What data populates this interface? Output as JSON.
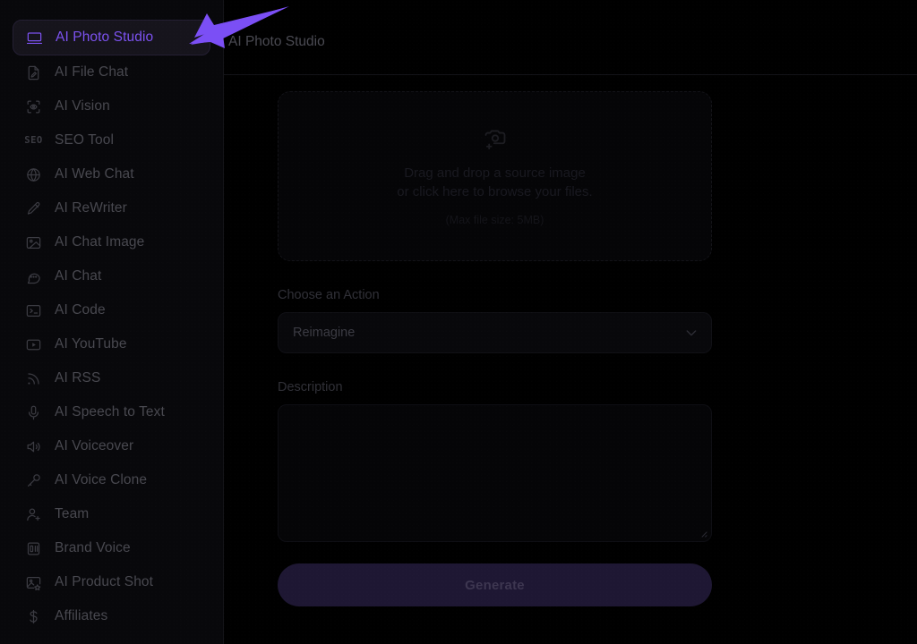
{
  "theme": {
    "accent": "#7c52f0",
    "arrow_color": "#7b4ff5",
    "background": "#000000",
    "sidebar_background": "#08080b",
    "active_item_background": "#16141c",
    "generate_button_background": "#1e1733"
  },
  "header": {
    "page_title": "AI Photo Studio"
  },
  "sidebar": {
    "items": [
      {
        "label": "AI Photo Studio",
        "icon": "laptop-icon",
        "active": true
      },
      {
        "label": "AI File Chat",
        "icon": "file-pen-icon",
        "active": false
      },
      {
        "label": "AI Vision",
        "icon": "scan-eye-icon",
        "active": false
      },
      {
        "label": "SEO Tool",
        "icon": "seo-text-icon",
        "active": false
      },
      {
        "label": "AI Web Chat",
        "icon": "globe-www-icon",
        "active": false
      },
      {
        "label": "AI ReWriter",
        "icon": "pen-icon",
        "active": false
      },
      {
        "label": "AI Chat Image",
        "icon": "image-icon",
        "active": false
      },
      {
        "label": "AI Chat",
        "icon": "message-dots-icon",
        "active": false
      },
      {
        "label": "AI Code",
        "icon": "terminal-icon",
        "active": false
      },
      {
        "label": "AI YouTube",
        "icon": "play-square-icon",
        "active": false
      },
      {
        "label": "AI RSS",
        "icon": "rss-icon",
        "active": false
      },
      {
        "label": "AI Speech to Text",
        "icon": "microphone-icon",
        "active": false
      },
      {
        "label": "AI Voiceover",
        "icon": "speaker-wave-icon",
        "active": false
      },
      {
        "label": "AI Voice Clone",
        "icon": "mic-handheld-icon",
        "active": false
      },
      {
        "label": "Team",
        "icon": "user-plus-icon",
        "active": false
      },
      {
        "label": "Brand Voice",
        "icon": "id-card-icon",
        "active": false
      },
      {
        "label": "AI Product Shot",
        "icon": "image-star-icon",
        "active": false
      },
      {
        "label": "Affiliates",
        "icon": "dollar-icon",
        "active": false
      }
    ]
  },
  "main": {
    "dropzone": {
      "icon": "camera-plus-icon",
      "line1": "Drag and drop a source image",
      "line2": "or click here to browse your files.",
      "hint": "(Max file size: 5MB)"
    },
    "action_field": {
      "label": "Choose an Action",
      "selected": "Reimagine",
      "chevron_icon": "chevron-down-icon"
    },
    "description_field": {
      "label": "Description",
      "value": "",
      "placeholder": "",
      "resize_icon": "resize-grip-icon"
    },
    "generate_button": {
      "label": "Generate"
    }
  },
  "annotation": {
    "arrow_icon": "pointer-arrow-icon",
    "points_to": "AI Photo Studio"
  }
}
